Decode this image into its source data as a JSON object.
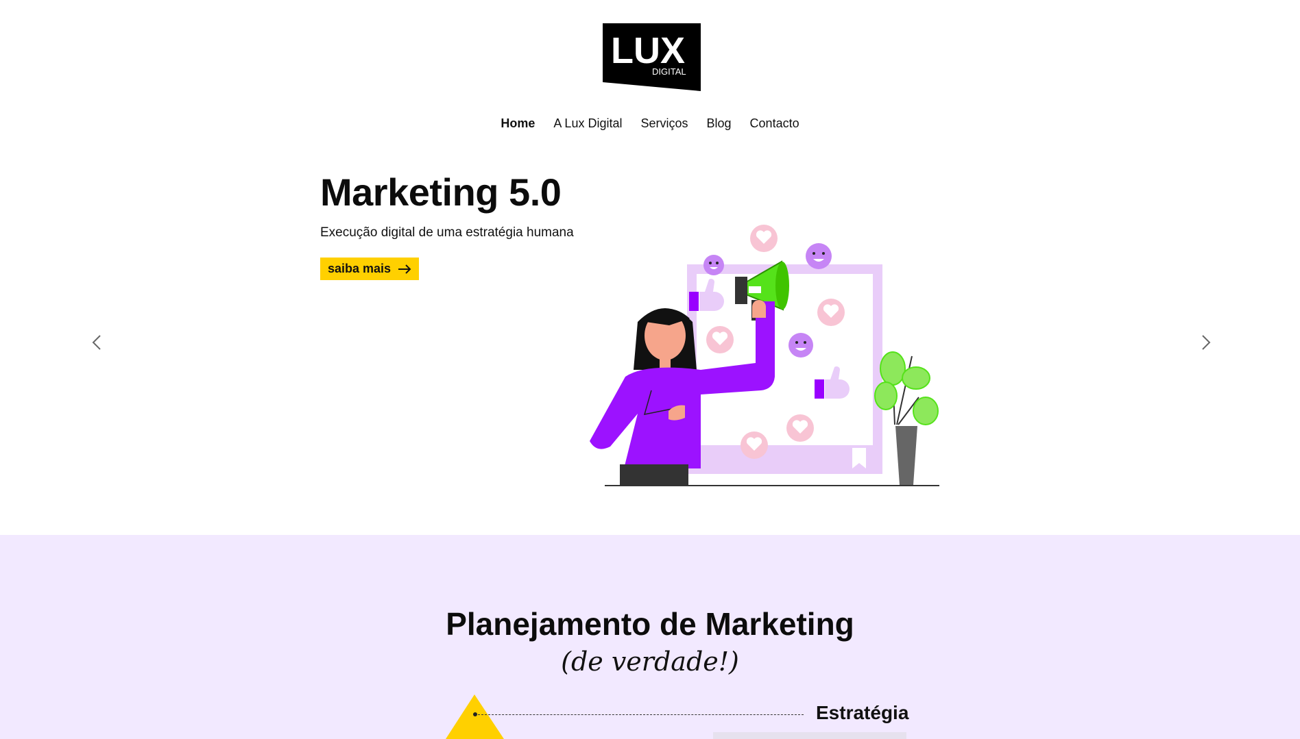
{
  "brand": {
    "logo_main": "LUX",
    "logo_sub": "DIGITAL"
  },
  "nav": {
    "items": [
      {
        "label": "Home",
        "active": true
      },
      {
        "label": "A Lux Digital",
        "active": false
      },
      {
        "label": "Serviços",
        "active": false
      },
      {
        "label": "Blog",
        "active": false
      },
      {
        "label": "Contacto",
        "active": false
      }
    ]
  },
  "hero": {
    "title": "Marketing 5.0",
    "subtitle": "Execução digital de uma estratégia humana",
    "cta_label": "saiba mais",
    "cta_icon": "arrow-right-icon",
    "prev_icon": "chevron-left-icon",
    "next_icon": "chevron-right-icon"
  },
  "planning": {
    "title": "Planejamento de Marketing",
    "subtitle": "(de verdade!)",
    "level_1": "Estratégia"
  },
  "colors": {
    "accent_yellow": "#ffd000",
    "purple": "#8a00ea",
    "lavender_bg": "#f2e9ff",
    "green": "#55e21a"
  }
}
